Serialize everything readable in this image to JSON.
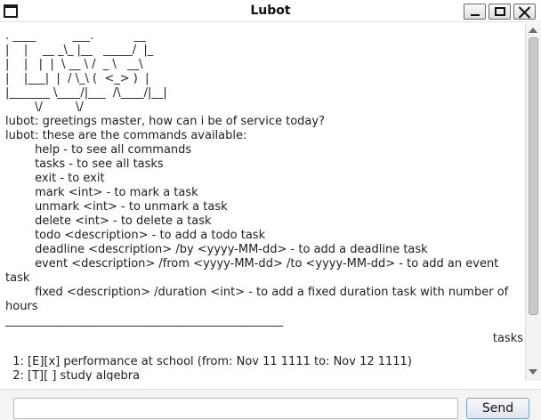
{
  "window": {
    "title": "Lubot"
  },
  "chat": {
    "bot_message": ". ____          ___.           __\n|    |    __ _\\_ |__   _____/  |_\n|    |   |  |  \\ __ \\ /  _ \\   __\\\n|    |___|  |  / \\_\\ (  <_> )  |\n|_______ \\____/|___  /\\____/|__|\n        \\/         \\/\nlubot: greetings master, how can i be of service today?\nlubot: these are the commands available:\n        help - to see all commands\n        tasks - to see all tasks\n        exit - to exit\n        mark <int> - to mark a task\n        unmark <int> - to unmark a task\n        delete <int> - to delete a task\n        todo <description> - to add a todo task\n        deadline <description> /by <yyyy-MM-dd> - to add a deadline task\n        event <description> /from <yyyy-MM-dd> /to <yyyy-MM-dd> - to add an event task\n        fixed <description> /duration <int> - to add a fixed duration task with number of hours\n________________________________________________",
    "user_message": "tasks",
    "task_reply": "  1: [E][x] performance at school (from: Nov 11 1111 to: Nov 12 1111)\n  2: [T][ ] study algebra"
  },
  "input": {
    "value": "",
    "placeholder": ""
  },
  "send_button": {
    "label": "Send"
  }
}
